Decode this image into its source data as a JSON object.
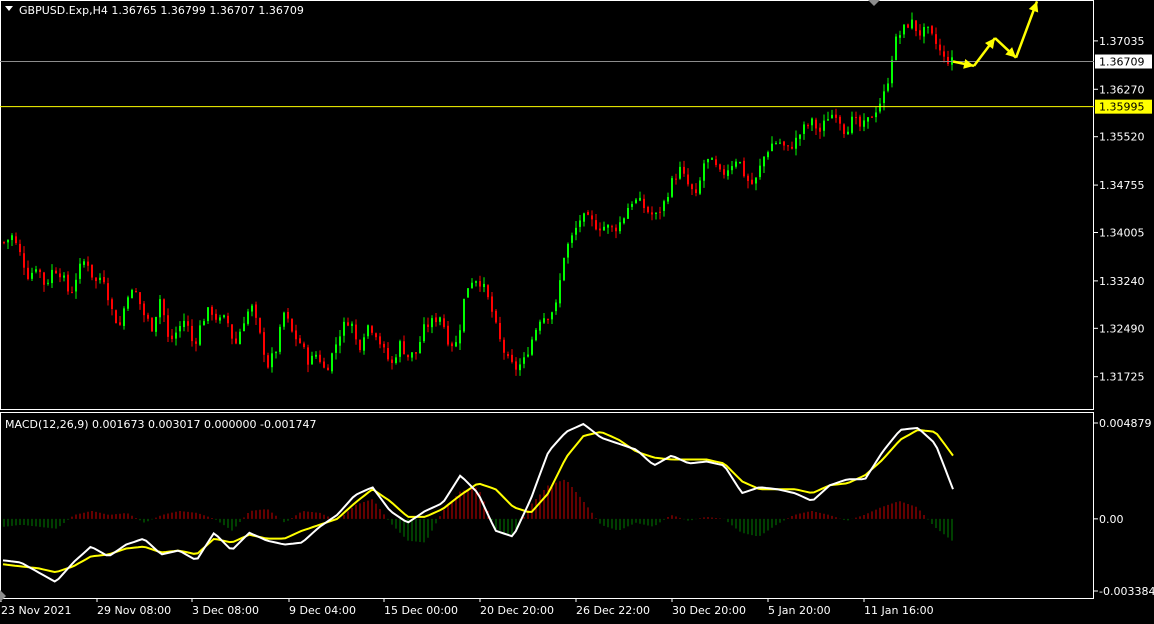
{
  "chart_header": {
    "symbol_line": "GBPUSD.Exp,H4  1.36765 1.36799 1.36707 1.36709"
  },
  "macd_header": {
    "label": "MACD(12,26,9) 0.001673 0.003017 0.000000 -0.001747"
  },
  "colors": {
    "background": "#000000",
    "bull_candle": "#00ff00",
    "bear_candle": "#ff0000",
    "price_line": "#8c8c8c",
    "level_line": "#ffff00",
    "macd_main": "#ffffff",
    "macd_signal": "#ffff00",
    "hist_positive": "#cc0000",
    "hist_negative": "#008000",
    "arrow": "#ffff00",
    "grid_border": "#ffffff"
  },
  "chart_data": [
    {
      "type": "candlestick",
      "symbol": "GBPUSD.Exp",
      "timeframe": "H4",
      "ohlc_last": {
        "open": 1.36765,
        "high": 1.36799,
        "low": 1.36707,
        "close": 1.36709
      },
      "y_tick_labels": [
        "1.37035",
        "1.36270",
        "1.35520",
        "1.34755",
        "1.34005",
        "1.33240",
        "1.32490",
        "1.31725"
      ],
      "ylim": [
        1.3123,
        1.3765
      ],
      "price_marker": {
        "value": 1.36709,
        "label": "1.36709"
      },
      "level_marker": {
        "value": 1.35995,
        "label": "1.35995"
      },
      "x_tick_labels": [
        "23 Nov 2021",
        "29 Nov 08:00",
        "3 Dec 08:00",
        "9 Dec 04:00",
        "15 Dec 00:00",
        "20 Dec 20:00",
        "26 Dec 22:00",
        "30 Dec 20:00",
        "5 Jan 20:00",
        "11 Jan 16:00"
      ],
      "close_path": [
        1.3385,
        1.3395,
        1.3365,
        1.333,
        1.335,
        1.3315,
        1.3345,
        1.3335,
        1.33,
        1.334,
        1.336,
        1.332,
        1.3335,
        1.328,
        1.325,
        1.3305,
        1.3305,
        1.327,
        1.325,
        1.33,
        1.3225,
        1.3245,
        1.3265,
        1.322,
        1.326,
        1.328,
        1.326,
        1.3265,
        1.322,
        1.326,
        1.3285,
        1.324,
        1.319,
        1.3215,
        1.3275,
        1.324,
        1.3225,
        1.3195,
        1.321,
        1.318,
        1.3215,
        1.325,
        1.3265,
        1.3215,
        1.3255,
        1.3245,
        1.3215,
        1.319,
        1.3225,
        1.3205,
        1.321,
        1.325,
        1.326,
        1.327,
        1.3225,
        1.3225,
        1.331,
        1.333,
        1.332,
        1.3285,
        1.3235,
        1.32,
        1.3185,
        1.3195,
        1.323,
        1.3265,
        1.327,
        1.3285,
        1.337,
        1.3395,
        1.3425,
        1.342,
        1.341,
        1.341,
        1.3405,
        1.342,
        1.345,
        1.345,
        1.3435,
        1.3425,
        1.3445,
        1.348,
        1.35,
        1.3475,
        1.3455,
        1.3515,
        1.351,
        1.349,
        1.3505,
        1.352,
        1.3485,
        1.3475,
        1.3515,
        1.354,
        1.3545,
        1.353,
        1.3545,
        1.3565,
        1.3575,
        1.356,
        1.3585,
        1.359,
        1.356,
        1.358,
        1.3565,
        1.358,
        1.36,
        1.3625,
        1.37,
        1.372,
        1.3735,
        1.3715,
        1.372,
        1.37,
        1.3675,
        1.3671
      ],
      "projection_path": [
        1.36709,
        1.3664,
        1.3708,
        1.3677,
        1.3766
      ]
    },
    {
      "type": "macd",
      "parameters": "12,26,9",
      "values": {
        "main": 0.001673,
        "signal": 0.003017,
        "histogram": 0.0,
        "last": -0.001747
      },
      "y_tick_labels": [
        "0.004879",
        "0.00",
        "-0.003384"
      ],
      "ylim": [
        -0.0038,
        0.0051
      ],
      "main_path": [
        -0.0021,
        -0.0022,
        -0.0027,
        -0.0032,
        -0.0022,
        -0.0014,
        -0.0019,
        -0.0013,
        -0.001,
        -0.0018,
        -0.0016,
        -0.0021,
        -0.0007,
        -0.0016,
        -0.0007,
        -0.0011,
        -0.0013,
        -0.0012,
        -0.0004,
        0.0002,
        0.0012,
        0.0016,
        0.0004,
        -0.0002,
        0.0004,
        0.0008,
        0.0022,
        0.0013,
        -0.0006,
        -0.0009,
        0.001,
        0.0034,
        0.0044,
        0.0048,
        0.0041,
        0.0038,
        0.0035,
        0.0027,
        0.0032,
        0.0028,
        0.0029,
        0.0027,
        0.0013,
        0.0016,
        0.0015,
        0.0013,
        0.0009,
        0.0017,
        0.002,
        0.002,
        0.0034,
        0.0045,
        0.0046,
        0.0038,
        0.0015
      ],
      "signal_path": [
        -0.0023,
        -0.0024,
        -0.0025,
        -0.0027,
        -0.0024,
        -0.0019,
        -0.0018,
        -0.0015,
        -0.0014,
        -0.0017,
        -0.0016,
        -0.0018,
        -0.001,
        -0.0012,
        -0.0008,
        -0.001,
        -0.001,
        -0.0006,
        -0.0003,
        0.0,
        0.0008,
        0.0015,
        0.0009,
        0.0001,
        0.0001,
        0.0005,
        0.0012,
        0.0018,
        0.0015,
        0.0006,
        0.0003,
        0.0013,
        0.0031,
        0.0042,
        0.0044,
        0.004,
        0.0034,
        0.0031,
        0.003,
        0.003,
        0.003,
        0.0028,
        0.0019,
        0.0015,
        0.0015,
        0.0015,
        0.0013,
        0.0017,
        0.0018,
        0.0022,
        0.003,
        0.004,
        0.0045,
        0.0044,
        0.0032
      ],
      "histogram_path": [
        -0.0004,
        -0.0003,
        -0.0004,
        -0.0005,
        0.0002,
        0.0004,
        0.0002,
        0.0003,
        -0.0002,
        0.0002,
        0.0004,
        0.0003,
        0.0,
        -0.0006,
        0.0004,
        0.0005,
        -0.0002,
        0.0004,
        0.0003,
        -0.0001,
        0.0007,
        0.001,
        -0.0002,
        -0.0011,
        -0.0012,
        0.0004,
        0.0014,
        0.0016,
        -0.0005,
        -0.0009,
        0.0007,
        0.0017,
        0.002,
        0.0009,
        -0.0003,
        -0.0006,
        -0.0002,
        -0.0004,
        0.0002,
        -0.0001,
        0.0001,
        0.0,
        -0.0007,
        -0.0009,
        -0.0003,
        0.0002,
        0.0004,
        0.0002,
        -0.0001,
        0.0002,
        0.0006,
        0.0009,
        0.0006,
        -0.0004,
        -0.0011
      ]
    }
  ]
}
